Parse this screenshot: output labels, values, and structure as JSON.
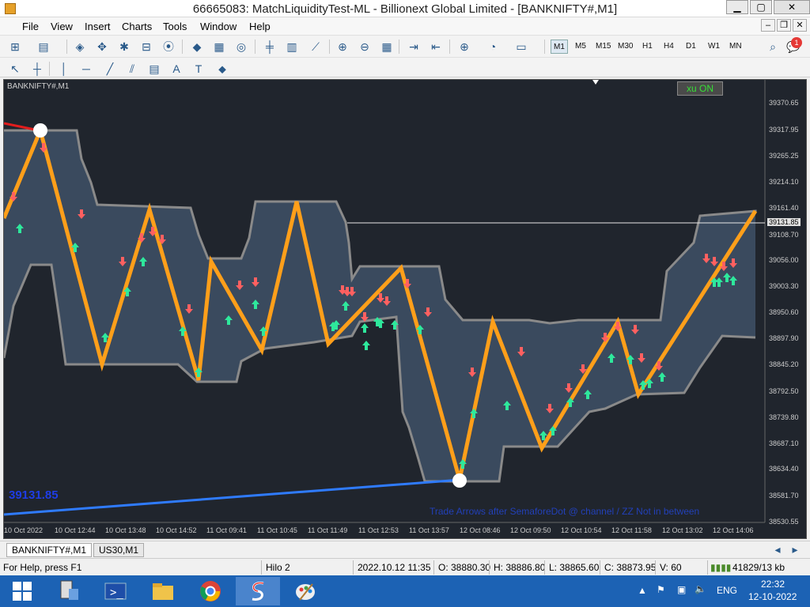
{
  "window": {
    "title": "66665083: MatchLiquidityTest-ML - Billionext Global Limited - [BANKNIFTY#,M1]",
    "min": "▁",
    "max": "▢",
    "close": "✕"
  },
  "menu": [
    "File",
    "View",
    "Insert",
    "Charts",
    "Tools",
    "Window",
    "Help"
  ],
  "timeframes": [
    "M1",
    "M5",
    "M15",
    "M30",
    "H1",
    "H4",
    "D1",
    "W1",
    "MN"
  ],
  "active_timeframe": "M1",
  "notification_count": "1",
  "chart": {
    "symbol_label": "BANKNIFTY#,M1",
    "indicator_button": "xu ON",
    "big_price": "39131.85",
    "footnote": "Trade Arrows after SemaforeDot @ channel / ZZ Not in between",
    "current_price": "39131.85",
    "price_ticks": [
      "39370.65",
      "39317.95",
      "39265.25",
      "39214.10",
      "39161.40",
      "39108.70",
      "39056.00",
      "39003.30",
      "38950.60",
      "38897.90",
      "38845.20",
      "38792.50",
      "38739.80",
      "38687.10",
      "38634.40",
      "38581.70",
      "38530.55"
    ],
    "time_ticks": [
      "10 Oct 2022",
      "10 Oct 12:44",
      "10 Oct 13:48",
      "10 Oct 14:52",
      "11 Oct 09:41",
      "11 Oct 10:45",
      "11 Oct 11:49",
      "11 Oct 12:53",
      "11 Oct 13:57",
      "12 Oct 08:46",
      "12 Oct 09:50",
      "12 Oct 10:54",
      "12 Oct 11:58",
      "12 Oct 13:02",
      "12 Oct 14:06"
    ],
    "colors": {
      "bg": "#20252d",
      "channel": "#3a4a5e",
      "channel_edge": "#8a8a8a",
      "zigzag": "#ff9f1a",
      "buy": "#2ee89c",
      "sell": "#ff6060",
      "trend": "#2f7bff"
    }
  },
  "tabs": [
    "BANKNIFTY#,M1",
    "US30,M1"
  ],
  "status": {
    "help": "For Help, press F1",
    "profile": "Hilo 2",
    "time": "2022.10.12 11:35",
    "open": "O: 38880.30",
    "high": "H: 38886.80",
    "low": "L: 38865.60",
    "close": "C: 38873.95",
    "volume": "V: 60",
    "traffic": "41829/13 kb"
  },
  "taskbar": {
    "lang": "ENG",
    "clock_time": "22:32",
    "clock_date": "12-10-2022"
  }
}
